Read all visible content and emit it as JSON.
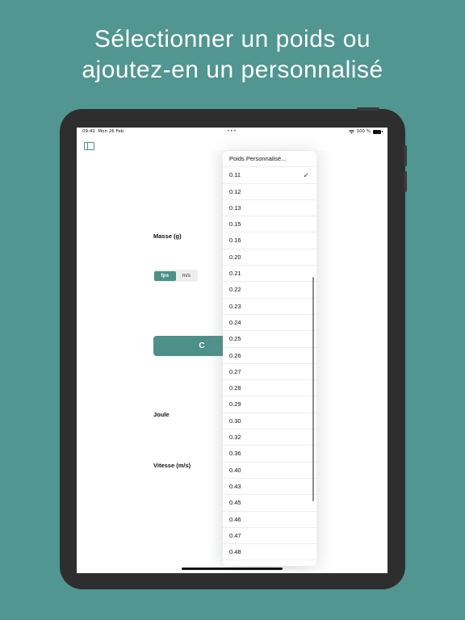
{
  "headline": {
    "line1": "Sélectionner un poids ou",
    "line2": "ajoutez-en un personnalisé"
  },
  "status_bar": {
    "time": "09:41",
    "date": "Mon 26 Feb",
    "battery": "100 %",
    "wifi_icon": "wifi-icon",
    "battery_icon": "battery-icon"
  },
  "toolbar": {
    "sidebar_icon": "sidebar-toggle-icon"
  },
  "form": {
    "mass_label": "Masse (g)",
    "unit_options": [
      "fps",
      "m/s"
    ],
    "unit_selected": "fps",
    "calculate_label": "C",
    "joule_label": "Joule",
    "speed_label": "Vitesse (m/s)"
  },
  "weight_menu": {
    "custom_label": "Poids Personnalisé...",
    "selected": "0.11",
    "options": [
      "0.11",
      "0.12",
      "0.13",
      "0.15",
      "0.16",
      "0.20",
      "0.21",
      "0.22",
      "0.23",
      "0.24",
      "0.25",
      "0.26",
      "0.27",
      "0.28",
      "0.29",
      "0.30",
      "0.32",
      "0.36",
      "0.40",
      "0.43",
      "0.45",
      "0.46",
      "0.47",
      "0.48"
    ]
  },
  "colors": {
    "background": "#519690",
    "accent": "#4d8f89",
    "device_frame": "#2e2e2e"
  }
}
